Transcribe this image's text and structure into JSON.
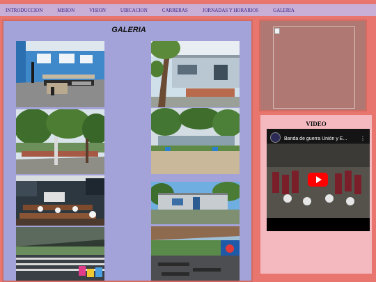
{
  "nav": {
    "items": [
      "INTRODUCCION",
      "MISION",
      "VISION",
      "UBICACION",
      "CARRERAS",
      "JORNADAS Y HORARIOS",
      "GALERIA"
    ]
  },
  "gallery": {
    "title": "GALERIA",
    "photos": [
      "computer-lab-photo",
      "school-building-tree-photo",
      "courtyard-trees-photo",
      "garden-building-photo",
      "classroom-students-photo",
      "blue-building-photo",
      "assembly-students-photo",
      "outdoor-cafeteria-photo"
    ]
  },
  "sidebar": {
    "video_heading": "VIDEO",
    "video_title": "Banda de guerra Unión y E...",
    "colors": {
      "play_button": "#ff0000"
    }
  }
}
